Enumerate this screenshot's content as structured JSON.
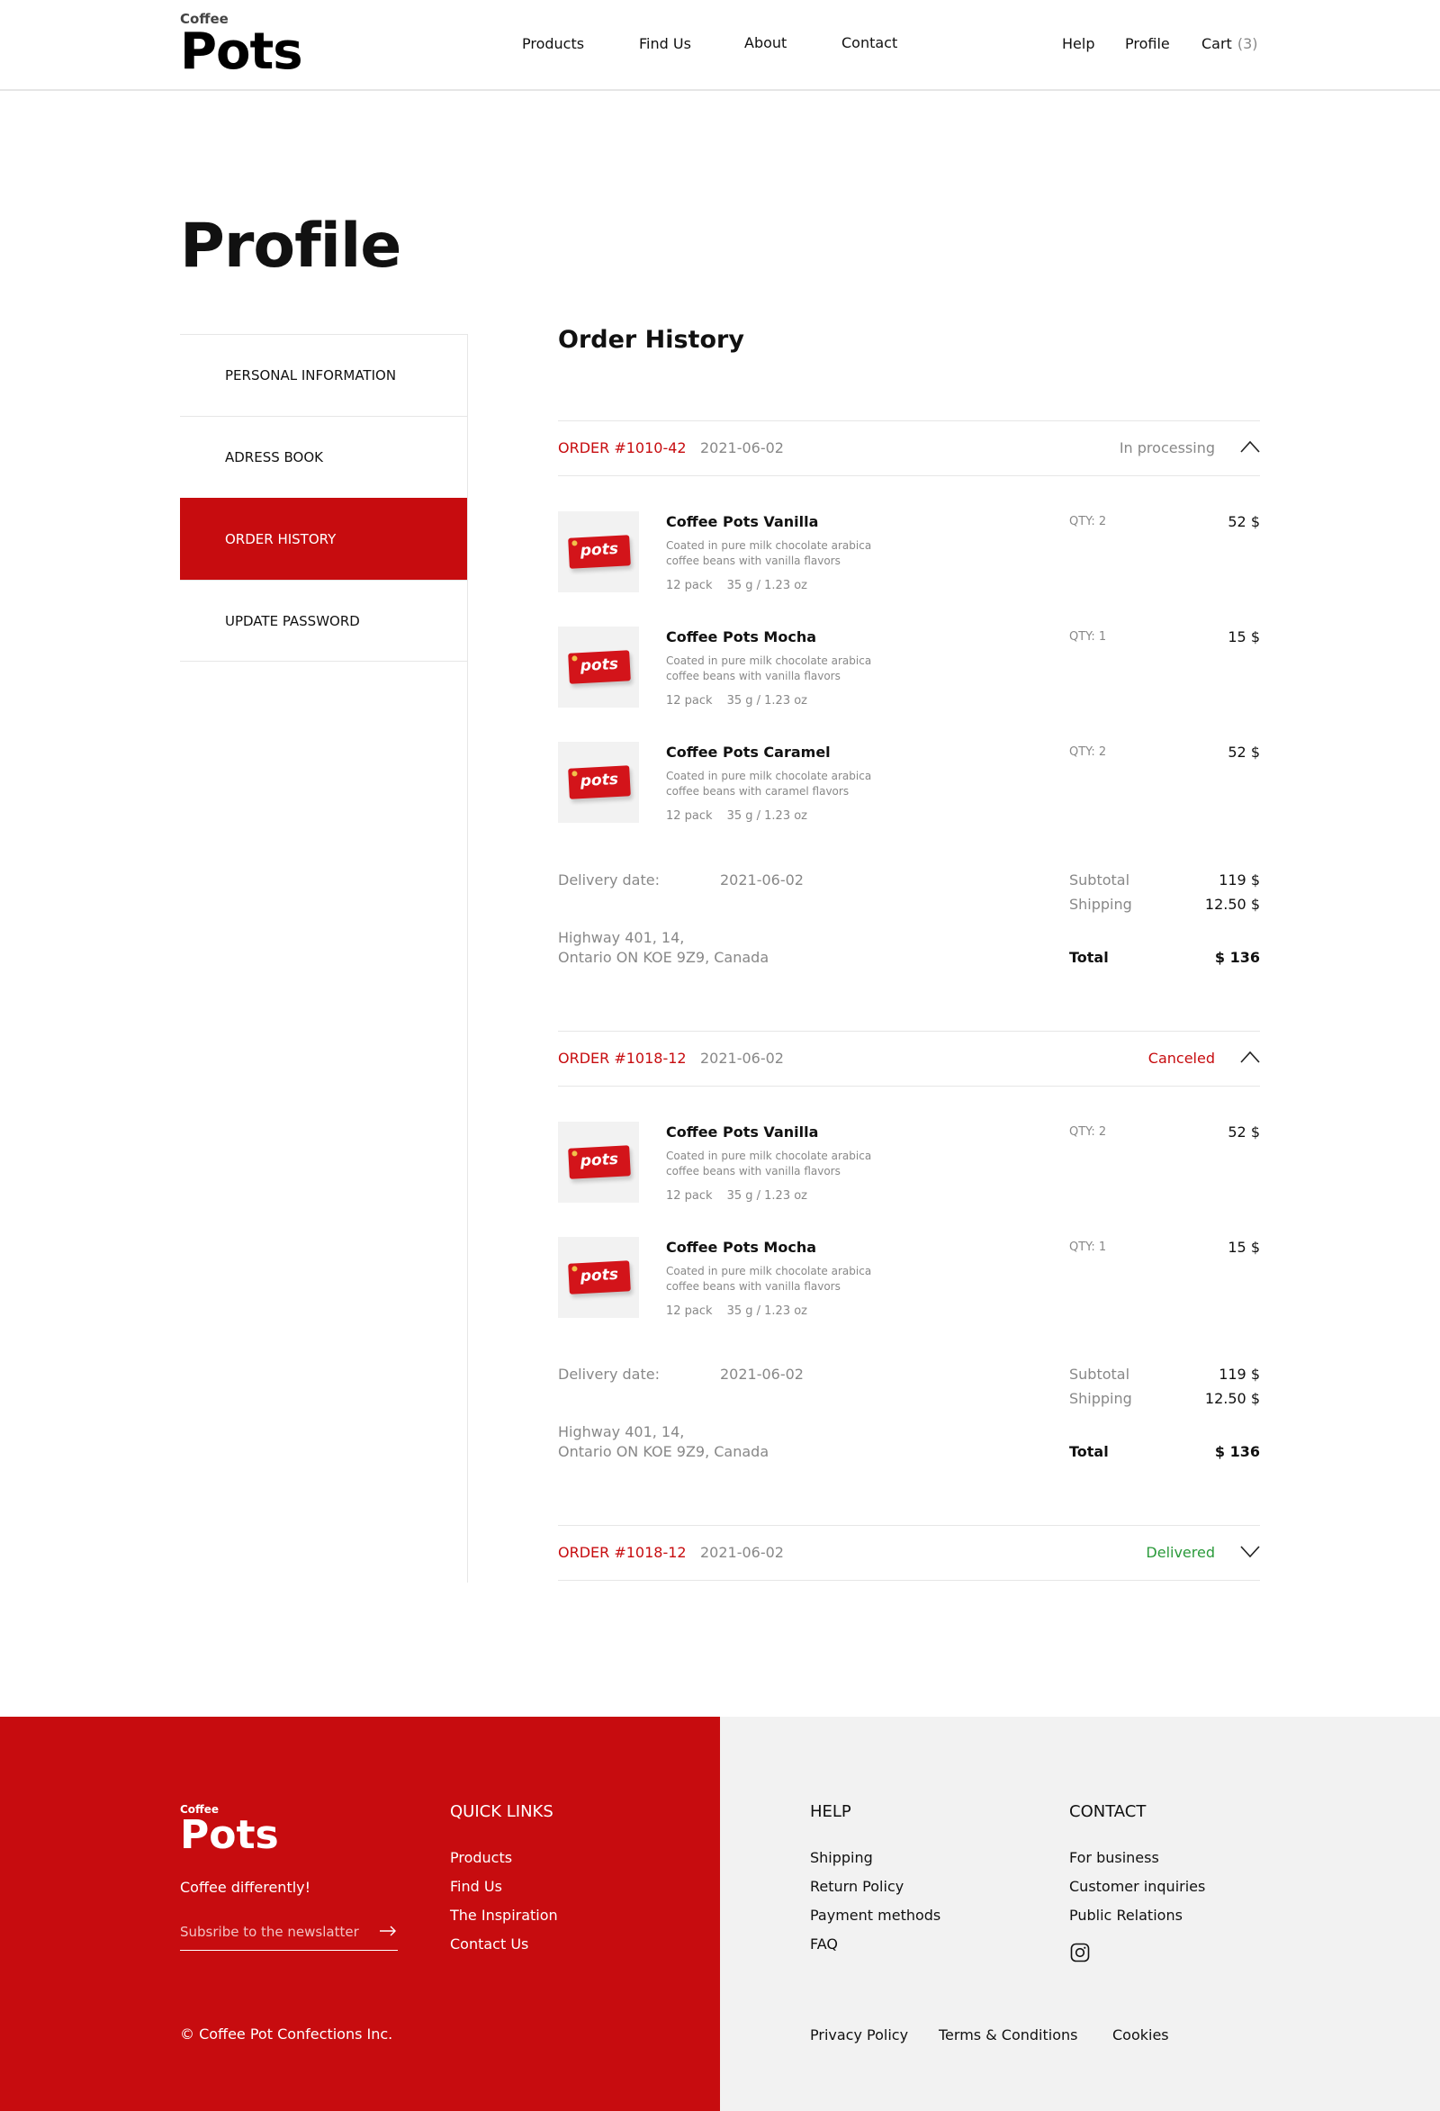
{
  "header": {
    "logo_small": "Coffee",
    "logo_big": "Pots",
    "nav": [
      "Products",
      "Find Us",
      "About",
      "Contact"
    ],
    "help": "Help",
    "profile": "Profile",
    "cart": "Cart",
    "cart_count": "(3)"
  },
  "page_title": "Profile",
  "sidebar": {
    "items": [
      {
        "label": "PERSONAL INFORMATION",
        "active": false
      },
      {
        "label": "ADRESS BOOK",
        "active": false
      },
      {
        "label": "ORDER HISTORY",
        "active": true
      },
      {
        "label": "UPDATE PASSWORD",
        "active": false
      }
    ]
  },
  "section_title": "Order History",
  "orders": [
    {
      "number": "ORDER #1010-42",
      "date": "2021-06-02",
      "status": "In processing",
      "status_color": "#888888",
      "expanded": true,
      "items": [
        {
          "name": "Coffee Pots Vanilla",
          "desc": "Coated in pure milk chocolate arabica coffee beans with vanilla flavors",
          "pack": "12 pack",
          "weight": "35 g / 1.23 oz",
          "qty": "QTY: 2",
          "price": "52 $"
        },
        {
          "name": "Coffee Pots Mocha",
          "desc": "Coated in pure milk chocolate arabica coffee beans with vanilla flavors",
          "pack": "12 pack",
          "weight": "35 g / 1.23 oz",
          "qty": "QTY: 1",
          "price": "15 $"
        },
        {
          "name": "Coffee Pots Caramel",
          "desc": "Coated in pure milk chocolate arabica coffee beans with caramel flavors",
          "pack": "12 pack",
          "weight": "35 g / 1.23 oz",
          "qty": "QTY: 2",
          "price": "52 $"
        }
      ],
      "delivery_label": "Delivery date:",
      "delivery_date": "2021-06-02",
      "address_line1": "Highway 401, 14,",
      "address_line2": "Ontario ON KOE 9Z9, Canada",
      "subtotal_label": "Subtotal",
      "subtotal": "119 $",
      "shipping_label": "Shipping",
      "shipping": "12.50 $",
      "total_label": "Total",
      "total": "$ 136"
    },
    {
      "number": "ORDER #1018-12",
      "date": "2021-06-02",
      "status": "Canceled",
      "status_color": "#c70c0f",
      "expanded": true,
      "items": [
        {
          "name": "Coffee Pots Vanilla",
          "desc": "Coated in pure milk chocolate arabica coffee beans with vanilla flavors",
          "pack": "12 pack",
          "weight": "35 g / 1.23 oz",
          "qty": "QTY: 2",
          "price": "52 $"
        },
        {
          "name": "Coffee Pots Mocha",
          "desc": "Coated in pure milk chocolate arabica coffee beans with vanilla flavors",
          "pack": "12 pack",
          "weight": "35 g / 1.23 oz",
          "qty": "QTY: 1",
          "price": "15 $"
        }
      ],
      "delivery_label": "Delivery date:",
      "delivery_date": "2021-06-02",
      "address_line1": "Highway 401, 14,",
      "address_line2": "Ontario ON KOE 9Z9, Canada",
      "subtotal_label": "Subtotal",
      "subtotal": "119 $",
      "shipping_label": "Shipping",
      "shipping": "12.50 $",
      "total_label": "Total",
      "total": "$ 136"
    },
    {
      "number": "ORDER #1018-12",
      "date": "2021-06-02",
      "status": "Delivered",
      "status_color": "#2a9a3a",
      "expanded": false
    }
  ],
  "product_image_text": "pots",
  "footer": {
    "logo_small": "Coffee",
    "logo_big": "Pots",
    "tagline": "Coffee differently!",
    "newsletter_placeholder": "Subsribe to the newslatter",
    "quick_links_title": "QUICK LINKS",
    "quick_links": [
      "Products",
      "Find Us",
      "The Inspiration",
      "Contact Us"
    ],
    "help_title": "HELP",
    "help_links": [
      "Shipping",
      "Return Policy",
      "Payment methods",
      "FAQ"
    ],
    "contact_title": "CONTACT",
    "contact_links": [
      "For business",
      "Customer inquiries",
      "Public Relations"
    ],
    "social_icon": "instagram-icon",
    "copyright": "© Coffee Pot Confections Inc.",
    "legal_links": [
      "Privacy Policy",
      "Terms & Conditions",
      "Cookies"
    ]
  },
  "colors": {
    "brand_red": "#c70c0f",
    "delivered_green": "#2a9a3a",
    "muted_text": "#888888",
    "footer_gray": "#f2f2f2"
  }
}
